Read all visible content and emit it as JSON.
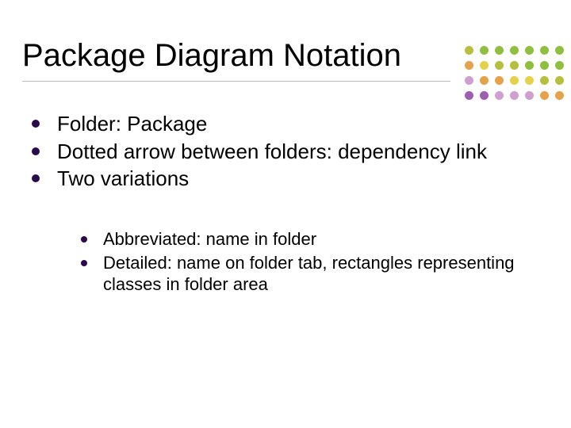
{
  "title": "Package Diagram Notation",
  "bullets": [
    {
      "text": "Folder:  Package"
    },
    {
      "text": "Dotted arrow between folders: dependency link"
    },
    {
      "text": "Two variations"
    }
  ],
  "sub_bullets": [
    {
      "text": "Abbreviated: name in folder"
    },
    {
      "text": "Detailed: name on folder tab, rectangles representing classes in folder area"
    }
  ],
  "dot_colors": {
    "green": "#8fbf3f",
    "olive": "#b7bf3f",
    "yellow": "#e6d24a",
    "orange": "#e6a24a",
    "mauve": "#cfa0cf",
    "purple": "#9f5fb0"
  },
  "dot_grid_pattern": [
    [
      "olive",
      "green",
      "green",
      "green",
      "green",
      "green",
      "green"
    ],
    [
      "orange",
      "yellow",
      "olive",
      "olive",
      "green",
      "green",
      "green"
    ],
    [
      "mauve",
      "orange",
      "orange",
      "yellow",
      "yellow",
      "olive",
      "olive"
    ],
    [
      "purple",
      "purple",
      "mauve",
      "mauve",
      "mauve",
      "orange",
      "orange"
    ]
  ]
}
